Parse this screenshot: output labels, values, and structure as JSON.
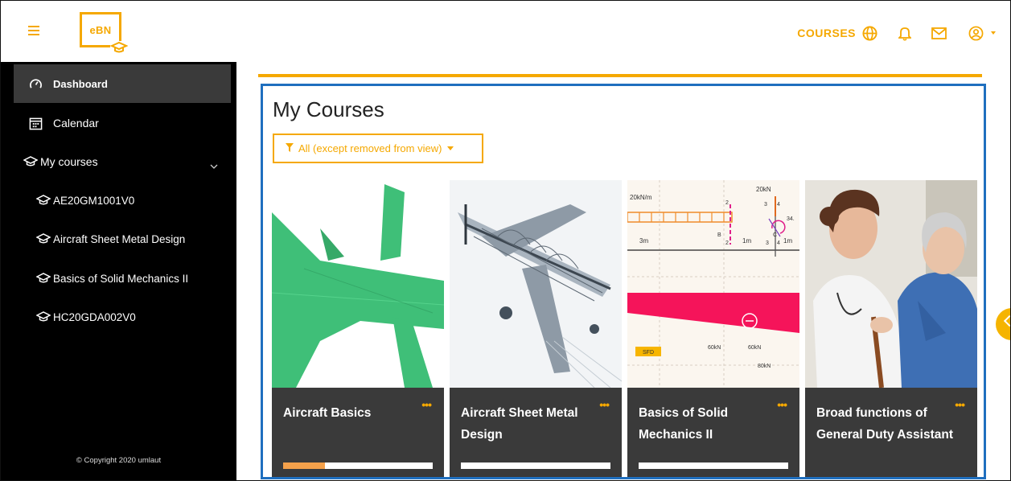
{
  "header": {
    "logo_text": "eBN",
    "courses_label": "COURSES",
    "icons": [
      "hamburger-icon",
      "globe-icon",
      "bell-icon",
      "mail-icon",
      "user-icon",
      "caret-down-icon"
    ],
    "accent": "#f5a800"
  },
  "sidebar": {
    "items": [
      {
        "label": "Dashboard",
        "icon": "dashboard-gauge-icon",
        "active": true
      },
      {
        "label": "Calendar",
        "icon": "calendar-icon"
      },
      {
        "label": "My courses",
        "icon": "graduation-cap-icon",
        "expandable": true
      },
      {
        "label": "AE20GM1001V0",
        "icon": "graduation-cap-icon"
      },
      {
        "label": "Aircraft Sheet Metal Design",
        "icon": "graduation-cap-icon"
      },
      {
        "label": "Basics of Solid Mechanics II",
        "icon": "graduation-cap-icon"
      },
      {
        "label": "HC20GDA002V0",
        "icon": "graduation-cap-icon"
      }
    ],
    "copyright": "© Copyright 2020 umlaut",
    "background": "#000000"
  },
  "main": {
    "heading": "My Courses",
    "filter_label": "All (except removed from view)",
    "frame_color": "#1f6fbf",
    "cards": [
      {
        "title": "Aircraft Basics",
        "menu": "•••",
        "progress": 0.28,
        "image": "green-airplane-image"
      },
      {
        "title": "Aircraft Sheet Metal Design",
        "menu": "•••",
        "progress": 0,
        "image": "aircraft-frame-image"
      },
      {
        "title": "Basics of Solid Mechanics II",
        "menu": "•••",
        "progress": 0,
        "image": "beam-diagram-image"
      },
      {
        "title": "Broad functions of General Duty Assistant",
        "menu": "•••",
        "progress": null,
        "image": "nurse-patient-image"
      }
    ],
    "diagram_labels": {
      "load": "20kN/m",
      "force": "20kN",
      "seg1": "3m",
      "seg2": "1m",
      "seg3": "1m",
      "point_b": "B",
      "point_c": "C",
      "sfd": "SFD",
      "v1": "60kN",
      "v2": "60kN",
      "v3": "80kN",
      "n2a": "2",
      "n2b": "2",
      "n3a": "3",
      "n3b": "3",
      "n4a": "4",
      "n4b": "4",
      "n34": "34."
    }
  }
}
